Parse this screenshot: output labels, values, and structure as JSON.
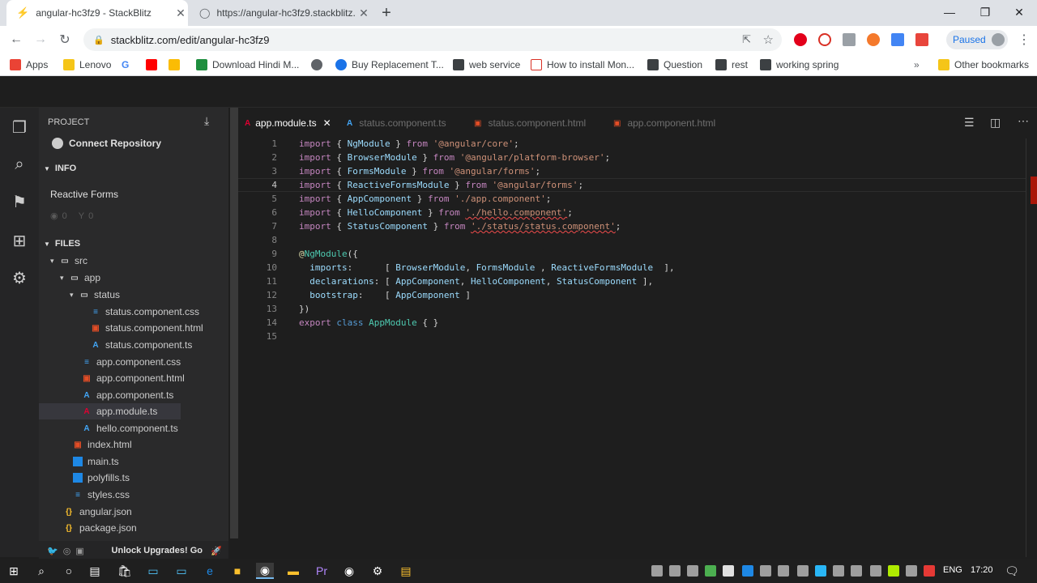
{
  "browser": {
    "tabs": [
      {
        "title": "angular-hc3fz9 - StackBlitz",
        "active": true
      },
      {
        "title": "https://angular-hc3fz9.stackblitz.",
        "active": false
      }
    ],
    "new_tab": "+",
    "url": "stackblitz.com/edit/angular-hc3fz9",
    "profile_status": "Paused",
    "bookmarks": [
      "Apps",
      "Lenovo",
      "Download Hindi M...",
      "Buy Replacement T...",
      "web service",
      "How to install Mon...",
      "Question",
      "rest",
      "working spring"
    ],
    "other_bookmarks": "Other bookmarks"
  },
  "sidebar": {
    "project_title": "PROJECT",
    "connect_repo": "Connect Repository",
    "info_title": "INFO",
    "project_name": "Reactive Forms",
    "views": "0",
    "forks": "0",
    "files_title": "FILES",
    "files": [
      {
        "name": "src",
        "type": "folder"
      },
      {
        "name": "app",
        "type": "folder"
      },
      {
        "name": "status",
        "type": "folder"
      },
      {
        "name": "status.component.css",
        "type": "css"
      },
      {
        "name": "status.component.html",
        "type": "html"
      },
      {
        "name": "status.component.ts",
        "type": "ng"
      },
      {
        "name": "app.component.css",
        "type": "css"
      },
      {
        "name": "app.component.html",
        "type": "html"
      },
      {
        "name": "app.component.ts",
        "type": "ng"
      },
      {
        "name": "app.module.ts",
        "type": "ngred"
      },
      {
        "name": "hello.component.ts",
        "type": "ng"
      },
      {
        "name": "index.html",
        "type": "html"
      },
      {
        "name": "main.ts",
        "type": "ts"
      },
      {
        "name": "polyfills.ts",
        "type": "ts"
      },
      {
        "name": "styles.css",
        "type": "css"
      },
      {
        "name": "angular.json",
        "type": "json"
      },
      {
        "name": "package.json",
        "type": "json"
      }
    ],
    "footer_text": "Unlock Upgrades! Go"
  },
  "editor": {
    "tabs": [
      {
        "name": "app.module.ts",
        "active": true
      },
      {
        "name": "status.component.ts",
        "active": false
      },
      {
        "name": "status.component.html",
        "active": false
      },
      {
        "name": "app.component.html",
        "active": false
      }
    ],
    "current_line": 4,
    "line_numbers": [
      "1",
      "2",
      "3",
      "4",
      "5",
      "6",
      "7",
      "8",
      "9",
      "10",
      "11",
      "12",
      "13",
      "14",
      "15"
    ]
  },
  "taskbar": {
    "lang": "ENG",
    "time": "17:20"
  },
  "colors": {
    "accent": "#dd0031",
    "editor_bg": "#1e1e1e",
    "sidebar_bg": "#2a2a2b"
  }
}
